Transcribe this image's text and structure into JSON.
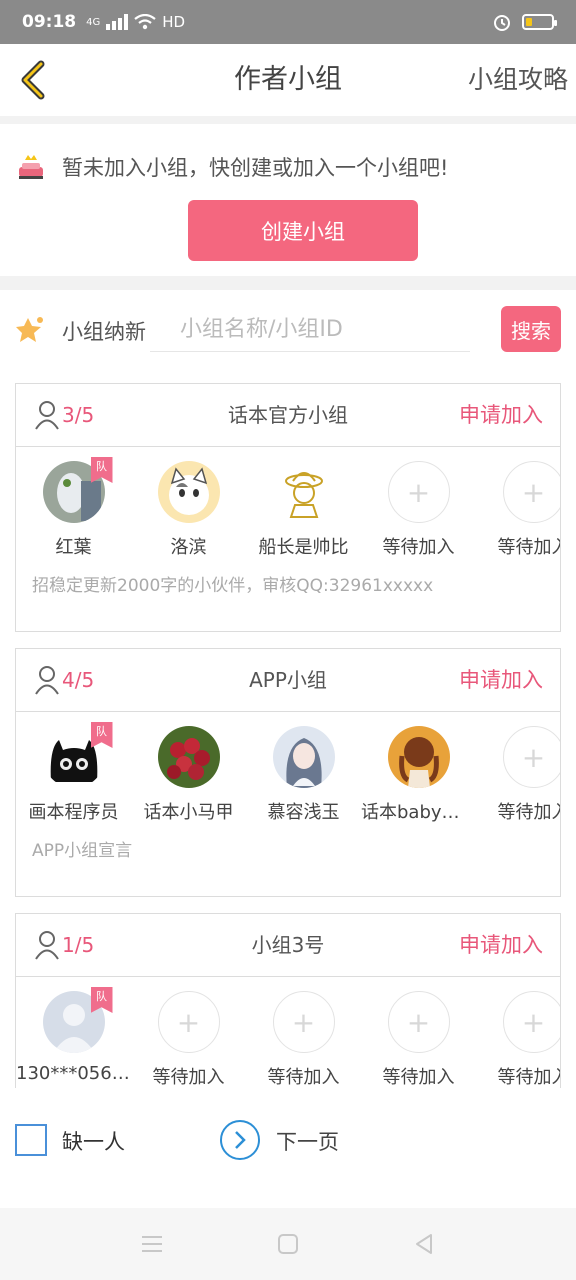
{
  "status": {
    "time": "09:18",
    "network": "4G",
    "hd": "HD"
  },
  "nav": {
    "title": "作者小组",
    "guide": "小组攻略"
  },
  "notice": {
    "message": "暂未加入小组，快创建或加入一个小组吧!",
    "create_label": "创建小组"
  },
  "search": {
    "label": "小组纳新",
    "placeholder": "小组名称/小组ID",
    "button": "搜索"
  },
  "badge_label": "队",
  "groups": [
    {
      "count": "3/5",
      "name": "话本官方小组",
      "apply": "申请加入",
      "members": [
        "红葉",
        "洛滨",
        "船长是帅比",
        "等待加入",
        "等待加入"
      ],
      "declaration": "招稳定更新2000字的小伙伴，审核QQ:32961xxxxx"
    },
    {
      "count": "4/5",
      "name": "APP小组",
      "apply": "申请加入",
      "members": [
        "画本程序员",
        "话本小马甲",
        "慕容浅玉",
        "话本baby安…",
        "等待加入"
      ],
      "declaration": "APP小组宣言"
    },
    {
      "count": "1/5",
      "name": "小组3号",
      "apply": "申请加入",
      "members": [
        "130***056_…",
        "等待加入",
        "等待加入",
        "等待加入",
        "等待加入"
      ],
      "declaration": ""
    }
  ],
  "bottom": {
    "checkbox_label": "缺一人",
    "next_label": "下一页"
  },
  "colors": {
    "accent": "#f4677f",
    "highlight": "#e8577a",
    "link_blue": "#2c8fd6"
  }
}
